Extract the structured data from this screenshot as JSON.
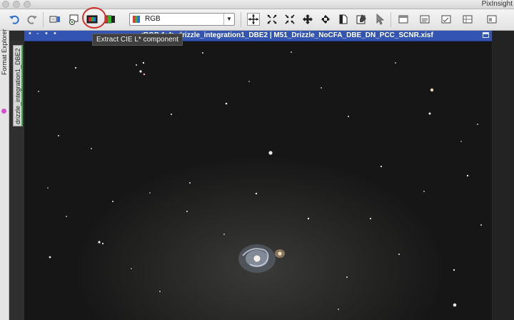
{
  "app": {
    "title": "PixInsight"
  },
  "toolbar": {
    "buttons": [
      {
        "name": "undo-button"
      },
      {
        "name": "redo-button"
      },
      {
        "name": "extract-rgb-button"
      },
      {
        "name": "rgb-combination-button"
      },
      {
        "name": "extract-lightness-button"
      },
      {
        "name": "channel-combination-button"
      },
      {
        "name": "cursor-button"
      },
      {
        "name": "zoom-in-button"
      },
      {
        "name": "zoom-out-button"
      },
      {
        "name": "pan-button"
      },
      {
        "name": "readout-button"
      },
      {
        "name": "preview-button"
      },
      {
        "name": "edit-button"
      },
      {
        "name": "select-button"
      },
      {
        "name": "tool-button"
      },
      {
        "name": "process-button"
      },
      {
        "name": "script-button"
      },
      {
        "name": "view-button"
      }
    ],
    "channel_combo": {
      "value": "RGB"
    }
  },
  "tooltip": {
    "text": "Extract CIE L* component"
  },
  "left_panel": {
    "tabs": [
      "Format Explorer"
    ]
  },
  "image_tab": {
    "label": "drizzle_integration1_DBE2"
  },
  "image_window": {
    "title": "<RGB 1:4> drizzle_integration1_DBE2 | M51_Drizzle_NoCFA_DBE_DN_PCC_SCNR.xisf"
  },
  "colors": {
    "window_title_bg": "#3355b1",
    "highlight": "#d6302a",
    "tab_accent": "#3fa84a"
  }
}
